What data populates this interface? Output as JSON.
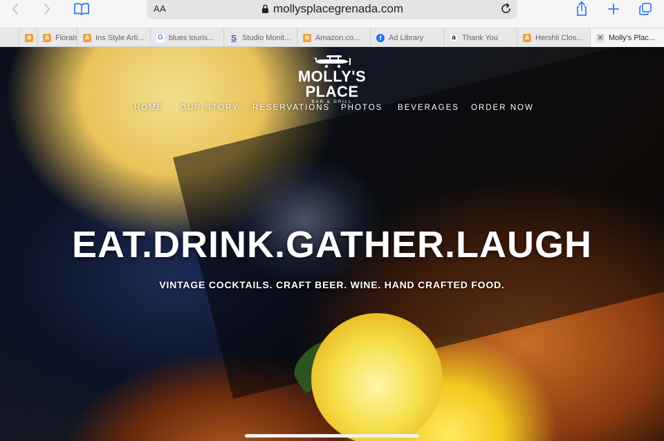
{
  "browser": {
    "url": "mollysplacegrenada.com",
    "reader_label": "AA",
    "tabs": [
      {
        "label": "",
        "icon": "amazon-icon"
      },
      {
        "label": "Florals",
        "icon": "amazon-icon"
      },
      {
        "label": "Ins Style Arti...",
        "icon": "amazon-icon"
      },
      {
        "label": "blues touris...",
        "icon": "google-icon"
      },
      {
        "label": "Studio Monit...",
        "icon": "studio-icon"
      },
      {
        "label": "Amazon.co...",
        "icon": "amazon-icon"
      },
      {
        "label": "Ad Library",
        "icon": "facebook-icon"
      },
      {
        "label": "Thank You",
        "icon": "amazon-icon"
      },
      {
        "label": "Hershii Clos...",
        "icon": "amazon-icon"
      },
      {
        "label": "Molly's Plac...",
        "icon": "close-icon",
        "active": true
      }
    ]
  },
  "site": {
    "logo_title": "MOLLY'S PLACE",
    "logo_subtitle": "BAR & GRILL",
    "nav": [
      "HOME",
      "OUR STORY",
      "RESERVATIONS",
      "PHOTOS",
      "BEVERAGES",
      "ORDER NOW"
    ],
    "headline": "EAT.DRINK.GATHER.LAUGH",
    "tagline": "VINTAGE COCKTAILS. CRAFT BEER. WINE. HAND CRAFTED FOOD."
  },
  "colors": {
    "accent": "#2f7cf6",
    "toolbar_bg": "#f6f6f7",
    "tab_bg": "#e8e8ea"
  }
}
